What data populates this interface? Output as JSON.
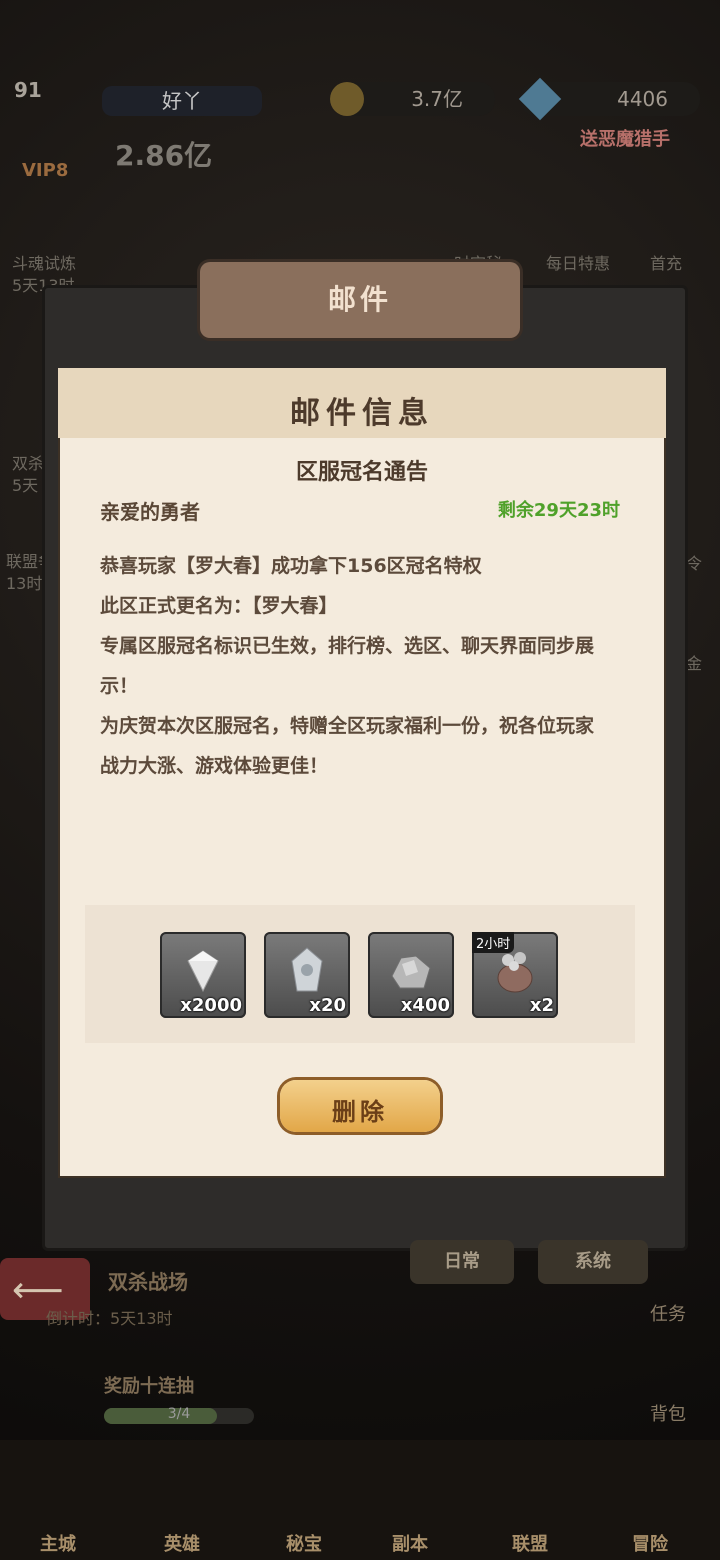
{
  "hud": {
    "level": "91",
    "player_name": "好丫",
    "power": "2.86亿",
    "vip": "VIP8",
    "coins": "3.7亿",
    "gems": "4406",
    "gift_banner": "送恶魔猎手",
    "left_labels": [
      "斗魂试炼",
      "5天13时",
      "双杀",
      "5天",
      "联盟争",
      "13时"
    ],
    "right_labels": [
      "时空秘",
      "每日特惠",
      "首充",
      "战令",
      "基金"
    ]
  },
  "dialog": {
    "tab_title": "邮件",
    "title": "邮件信息",
    "subject": "区服冠名通告",
    "greeting": "亲爱的勇者",
    "remaining": "剩余29天23时",
    "body_lines": [
      "恭喜玩家【罗大春】成功拿下156区冠名特权",
      "此区正式更名为：【罗大春】",
      "专属区服冠名标识已生效，排行榜、选区、聊天界面同步展",
      "示！",
      "为庆贺本次区服冠名，特赠全区玩家福利一份，祝各位玩家",
      "战力大涨、游戏体验更佳！"
    ],
    "rewards": [
      {
        "icon": "diamond-icon",
        "qty": "x2000",
        "tag": ""
      },
      {
        "icon": "crystal-shard-icon",
        "qty": "x20",
        "tag": ""
      },
      {
        "icon": "ore-icon",
        "qty": "x400",
        "tag": ""
      },
      {
        "icon": "coin-bag-icon",
        "qty": "x2",
        "tag": "2小时"
      }
    ],
    "delete_label": "删除"
  },
  "bottom": {
    "tabs": [
      "日常",
      "系统"
    ],
    "mission_title": "双杀战场",
    "mission_timer": "倒计时：5天13时",
    "reward_text": "奖励十连抽",
    "progress_text": "3/4",
    "progress": 0.75,
    "side_labels": [
      "任务",
      "背包"
    ],
    "nav": [
      "主城",
      "英雄",
      "秘宝",
      "副本",
      "联盟",
      "冒险"
    ]
  }
}
